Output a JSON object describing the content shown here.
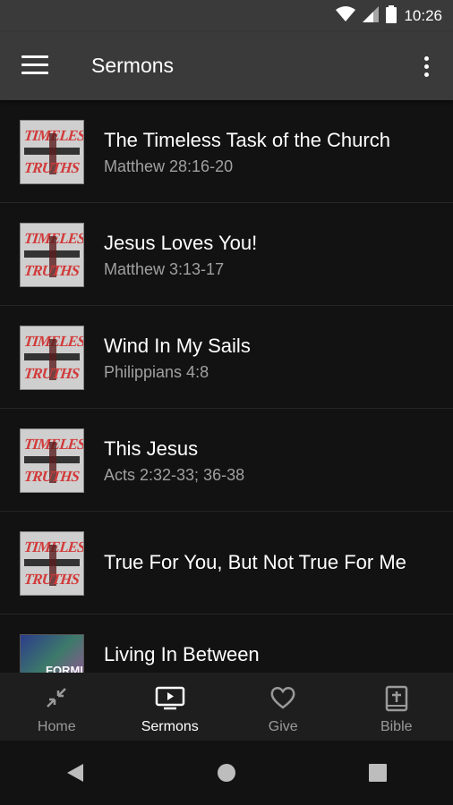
{
  "status_bar": {
    "time": "10:26"
  },
  "app_bar": {
    "title": "Sermons"
  },
  "sermons": [
    {
      "title": "The Timeless Task of the Church",
      "reference": "Matthew 28:16-20",
      "thumb_text": [
        "TIMELESS",
        "TRUTHS"
      ]
    },
    {
      "title": "Jesus Loves You!",
      "reference": "Matthew 3:13-17",
      "thumb_text": [
        "TIMELESS",
        "TRUTHS"
      ]
    },
    {
      "title": "Wind In My Sails",
      "reference": "Philippians 4:8",
      "thumb_text": [
        "TIMELESS",
        "TRUTHS"
      ]
    },
    {
      "title": "This Jesus",
      "reference": "Acts 2:32-33; 36-38",
      "thumb_text": [
        "TIMELESS",
        "TRUTHS"
      ]
    },
    {
      "title": "True For You, But Not True For Me",
      "reference": "",
      "thumb_text": [
        "TIMELESS",
        "TRUTHS"
      ]
    },
    {
      "title": "Living In Between",
      "reference": "",
      "thumb_text": [
        "FORMI"
      ]
    }
  ],
  "bottom_nav": [
    {
      "label": "Home",
      "icon": "collapse-arrows-icon",
      "active": false
    },
    {
      "label": "Sermons",
      "icon": "tv-play-icon",
      "active": true
    },
    {
      "label": "Give",
      "icon": "heart-icon",
      "active": false
    },
    {
      "label": "Bible",
      "icon": "bible-book-icon",
      "active": false
    }
  ],
  "colors": {
    "app_bar": "#3a3a3a",
    "background": "#121212",
    "secondary_text": "#a0a0a0",
    "thumb_red": "#d23a3a"
  }
}
